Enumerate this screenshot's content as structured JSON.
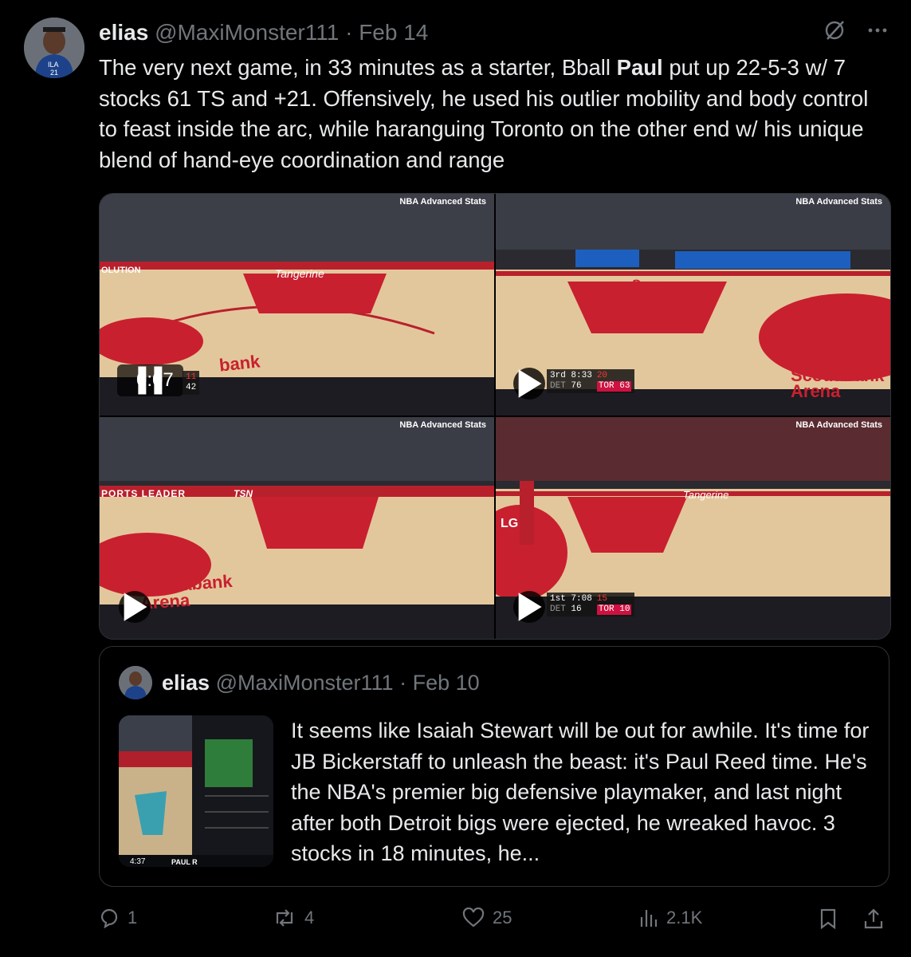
{
  "tweet": {
    "author_name": "elias",
    "handle": "@MaxiMonster111",
    "separator": "·",
    "date": "Feb 14",
    "text_before_bold": "The very next game, in 33 minutes as a starter, Bball ",
    "text_bold": "Paul",
    "text_after_bold": " put up 22-5-3 w/ 7 stocks 61 TS and +21. Offensively, he used his outlier mobility and body control to feast inside the arc, while haranguing Toronto on the other end w/ his unique blend of hand-eye coordination and range",
    "icons": [
      "grok-icon",
      "more-icon"
    ]
  },
  "media": {
    "watermark": "NBA Advanced Stats",
    "videos": [
      {
        "id": "video-1",
        "timer": "0:07",
        "score_a": "11",
        "score_b": "42"
      },
      {
        "id": "video-2",
        "quarter": "3rd",
        "clock": "8:33",
        "shot": "20",
        "team_a": "DET",
        "team_a_score": "76",
        "team_b": "TOR",
        "team_b_score": "63"
      },
      {
        "id": "video-3"
      },
      {
        "id": "video-4",
        "quarter": "1st",
        "clock": "7:08",
        "shot": "15",
        "team_a": "DET",
        "team_a_score": "16",
        "team_b": "TOR",
        "team_b_score": "10"
      }
    ],
    "court_text": {
      "tangerine": "Tangerine",
      "scotiabank": "Scotiabank",
      "arena": "Arena",
      "tsn": "TSN",
      "lg": "LG",
      "ports_leader": "PORTS LEADER",
      "lution": "OLUTION",
      "bank": "bank"
    }
  },
  "quote": {
    "author_name": "elias",
    "handle": "@MaxiMonster111",
    "separator": "·",
    "date": "Feb 10",
    "text": "It seems like Isaiah Stewart will be out for awhile. It's time for JB Bickerstaff to unleash the beast: it's Paul Reed time. He's the NBA's premier big defensive playmaker, and last night after both Detroit bigs were ejected, he wreaked havoc. 3 stocks in 18 minutes, he...",
    "thumb_clock": "4:37",
    "thumb_label": "PAUL R"
  },
  "actions": {
    "replies": "1",
    "reposts": "4",
    "likes": "25",
    "views": "2.1K"
  },
  "colors": {
    "background": "#000000",
    "text": "#e7e9ea",
    "muted": "#71767b",
    "border": "#2f3336",
    "raptors_red": "#ce1141",
    "court": "#e6c79c"
  }
}
